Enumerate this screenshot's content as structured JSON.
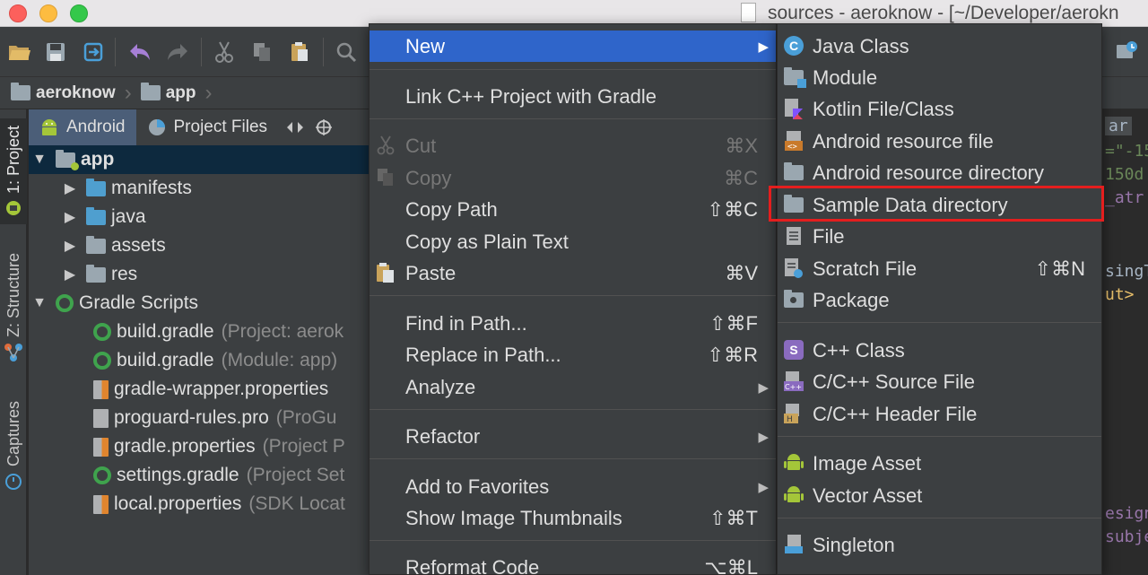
{
  "window": {
    "title": "sources - aeroknow - [~/Developer/aerokn"
  },
  "breadcrumb": [
    {
      "label": "aeroknow"
    },
    {
      "label": "app"
    }
  ],
  "left_strip": {
    "tabs": [
      "1: Project",
      "Z: Structure",
      "Captures"
    ]
  },
  "project_panel": {
    "tabs": [
      {
        "label": "Android"
      },
      {
        "label": "Project Files"
      }
    ],
    "tree": [
      {
        "label": "app",
        "detail": "",
        "icon": "module-folder-icon"
      },
      {
        "label": "manifests",
        "detail": "",
        "icon": "folder-icon"
      },
      {
        "label": "java",
        "detail": "",
        "icon": "folder-icon"
      },
      {
        "label": "assets",
        "detail": "",
        "icon": "resource-folder-icon"
      },
      {
        "label": "res",
        "detail": "",
        "icon": "resource-folder-icon"
      },
      {
        "label": "Gradle Scripts",
        "detail": "",
        "icon": "gradle-icon"
      },
      {
        "label": "build.gradle",
        "detail": "(Project: aerok",
        "icon": "gradle-icon"
      },
      {
        "label": "build.gradle",
        "detail": "(Module: app)",
        "icon": "gradle-icon"
      },
      {
        "label": "gradle-wrapper.properties",
        "detail": "",
        "icon": "properties-file-icon"
      },
      {
        "label": "proguard-rules.pro",
        "detail": "(ProGu",
        "icon": "text-file-icon"
      },
      {
        "label": "gradle.properties",
        "detail": "(Project P",
        "icon": "properties-file-icon"
      },
      {
        "label": "settings.gradle",
        "detail": "(Project Set",
        "icon": "gradle-icon"
      },
      {
        "label": "local.properties",
        "detail": "(SDK Locat",
        "icon": "properties-file-icon"
      }
    ]
  },
  "editor": {
    "lines": [
      {
        "text": "ar",
        "color": "#a9b7c6"
      },
      {
        "text": "=\"-15",
        "color": "#6a8759"
      },
      {
        "text": "150d",
        "color": "#6a8759"
      },
      {
        "text": "_atr",
        "color": "#9876aa"
      },
      {
        "text": "singT",
        "color": "#a9b7c6"
      },
      {
        "text": "ut>",
        "color": "#e8bf6a"
      },
      {
        "text": "esign",
        "color": "#9876aa"
      },
      {
        "text": "subje",
        "color": "#9876aa"
      }
    ]
  },
  "context_menu": {
    "items": [
      {
        "label": "New",
        "shortcut": "",
        "submenu": true,
        "state": "active",
        "icon": ""
      },
      {
        "label": "Link C++ Project with Gradle",
        "shortcut": "",
        "submenu": false,
        "state": "normal",
        "icon": ""
      },
      {
        "label": "Cut",
        "shortcut": "⌘X",
        "submenu": false,
        "state": "disabled",
        "icon": "scissors-icon"
      },
      {
        "label": "Copy",
        "shortcut": "⌘C",
        "submenu": false,
        "state": "disabled",
        "icon": "copy-icon"
      },
      {
        "label": "Copy Path",
        "shortcut": "⇧⌘C",
        "submenu": false,
        "state": "normal",
        "icon": ""
      },
      {
        "label": "Copy as Plain Text",
        "shortcut": "",
        "submenu": false,
        "state": "normal",
        "icon": ""
      },
      {
        "label": "Paste",
        "shortcut": "⌘V",
        "submenu": false,
        "state": "normal",
        "icon": "paste-icon"
      },
      {
        "label": "Find in Path...",
        "shortcut": "⇧⌘F",
        "submenu": false,
        "state": "normal",
        "icon": ""
      },
      {
        "label": "Replace in Path...",
        "shortcut": "⇧⌘R",
        "submenu": false,
        "state": "normal",
        "icon": ""
      },
      {
        "label": "Analyze",
        "shortcut": "",
        "submenu": true,
        "state": "normal",
        "icon": ""
      },
      {
        "label": "Refactor",
        "shortcut": "",
        "submenu": true,
        "state": "normal",
        "icon": ""
      },
      {
        "label": "Add to Favorites",
        "shortcut": "",
        "submenu": true,
        "state": "normal",
        "icon": ""
      },
      {
        "label": "Show Image Thumbnails",
        "shortcut": "⇧⌘T",
        "submenu": false,
        "state": "normal",
        "icon": ""
      },
      {
        "label": "Reformat Code",
        "shortcut": "⌥⌘L",
        "submenu": false,
        "state": "normal",
        "icon": ""
      }
    ]
  },
  "new_submenu": {
    "items": [
      {
        "label": "Java Class",
        "shortcut": "",
        "icon": "java-class-icon"
      },
      {
        "label": "Module",
        "shortcut": "",
        "icon": "module-icon"
      },
      {
        "label": "Kotlin File/Class",
        "shortcut": "",
        "icon": "kotlin-file-icon"
      },
      {
        "label": "Android resource file",
        "shortcut": "",
        "icon": "android-resource-file-icon"
      },
      {
        "label": "Android resource directory",
        "shortcut": "",
        "icon": "folder-icon"
      },
      {
        "label": "Sample Data directory",
        "shortcut": "",
        "icon": "folder-icon"
      },
      {
        "label": "File",
        "shortcut": "",
        "icon": "file-icon"
      },
      {
        "label": "Scratch File",
        "shortcut": "⇧⌘N",
        "icon": "scratch-file-icon"
      },
      {
        "label": "Package",
        "shortcut": "",
        "icon": "package-icon"
      },
      {
        "label": "C++ Class",
        "shortcut": "",
        "icon": "cpp-class-icon"
      },
      {
        "label": "C/C++ Source File",
        "shortcut": "",
        "icon": "cpp-source-icon"
      },
      {
        "label": "C/C++ Header File",
        "shortcut": "",
        "icon": "cpp-header-icon"
      },
      {
        "label": "Image Asset",
        "shortcut": "",
        "icon": "android-icon"
      },
      {
        "label": "Vector Asset",
        "shortcut": "",
        "icon": "android-icon"
      },
      {
        "label": "Singleton",
        "shortcut": "",
        "icon": "singleton-icon"
      }
    ],
    "highlighted": "Sample Data directory",
    "highlight_color": "#e41e1e"
  }
}
